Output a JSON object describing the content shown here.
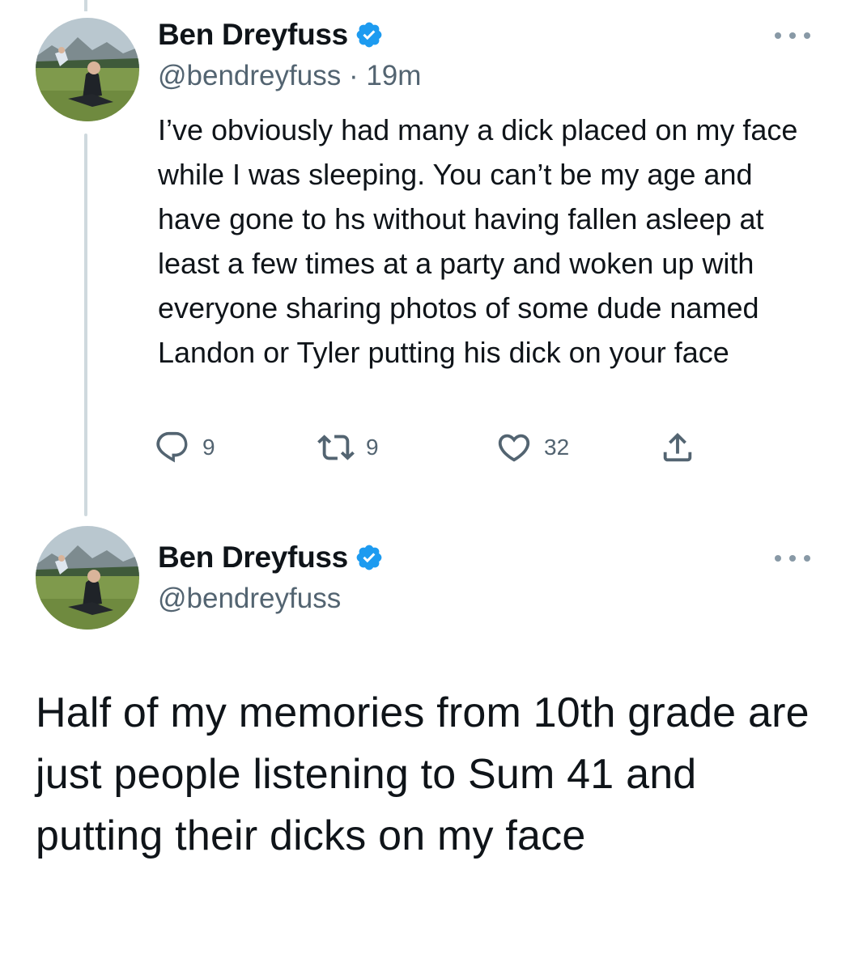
{
  "tweets": [
    {
      "author_name": "Ben Dreyfuss",
      "handle": "@bendreyfuss",
      "separator": "·",
      "time": "19m",
      "text": "I’ve obviously had many a dick placed on my face while I was sleeping. You can’t be my age and have gone to hs without having fallen asleep at least a few times at a party and woken up with everyone sharing photos of some dude named Landon or Tyler putting his dick on your face",
      "actions": {
        "reply_count": "9",
        "retweet_count": "9",
        "like_count": "32"
      }
    },
    {
      "author_name": "Ben Dreyfuss",
      "handle": "@bendreyfuss",
      "text": "Half of my memories from 10th grade are just people listening to Sum 41 and putting their dicks on my face"
    }
  ],
  "icons": {
    "verified": "verified-badge-icon",
    "more": "more-options-icon",
    "reply": "reply-icon",
    "retweet": "retweet-icon",
    "like": "like-icon",
    "share": "share-icon"
  },
  "colors": {
    "verified_blue": "#1d9bf0",
    "secondary_text": "#536471",
    "thread_line": "#cfd9de"
  }
}
